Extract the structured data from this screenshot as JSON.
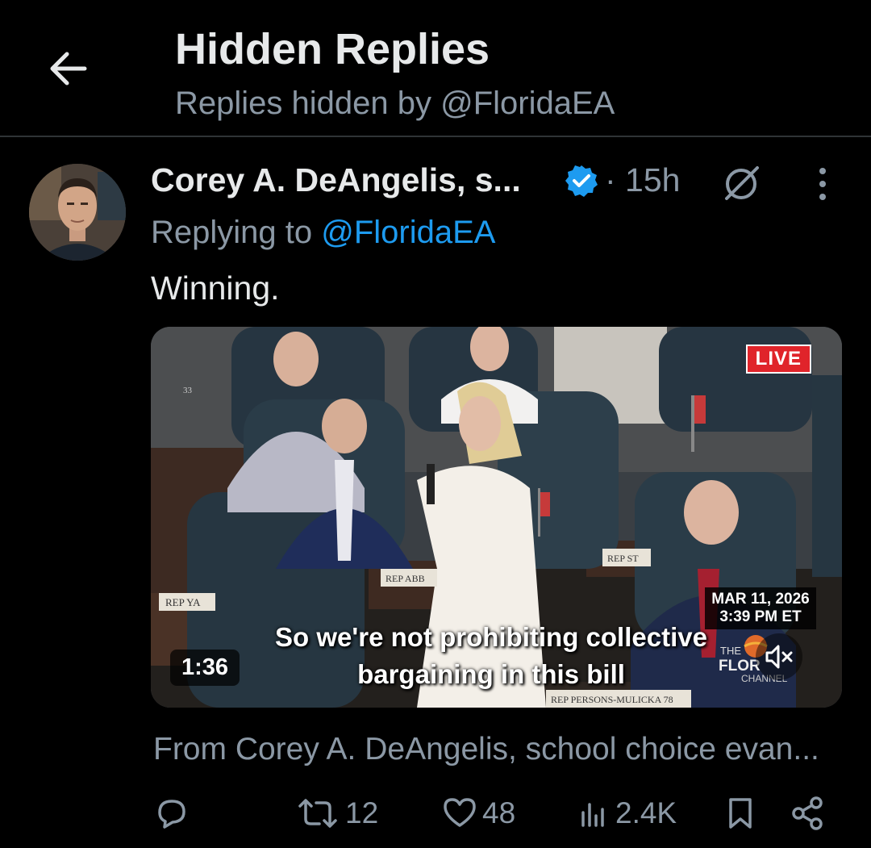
{
  "header": {
    "title": "Hidden Replies",
    "subtitle": "Replies hidden by @FloridaEA"
  },
  "post": {
    "author_name": "Corey A. DeAngelis, s...",
    "verified": true,
    "time": "· 15h",
    "replying_label": "Replying to ",
    "replying_handle": "@FloridaEA",
    "text": "Winning.",
    "video": {
      "live_label": "LIVE",
      "date": "MAR 11, 2026",
      "time": "3:39 PM ET",
      "caption_line1": "So we're not prohibiting collective",
      "caption_line2": "bargaining in this bill",
      "duration": "1:36",
      "channel_the": "THE",
      "channel_name": "FLOR",
      "channel_sub": "CHANNEL",
      "placards": [
        "REP YA",
        "REP ABB",
        "REP ST",
        "REP PERSONS-MULICKA 78",
        "33"
      ]
    },
    "from_line": "From Corey A. DeAngelis, school choice evan...",
    "actions": {
      "reposts": "12",
      "likes": "48",
      "views": "2.4K"
    }
  },
  "colors": {
    "background": "#000000",
    "primary_text": "#e7e9ea",
    "secondary_text": "#8b98a5",
    "accent": "#1d9bf0",
    "live_red": "#e0242a"
  },
  "icons": [
    "back-arrow-icon",
    "verified-badge-icon",
    "hidden-reply-icon",
    "more-icon",
    "mute-icon",
    "reply-icon",
    "repost-icon",
    "like-icon",
    "views-icon",
    "bookmark-icon",
    "share-icon"
  ]
}
